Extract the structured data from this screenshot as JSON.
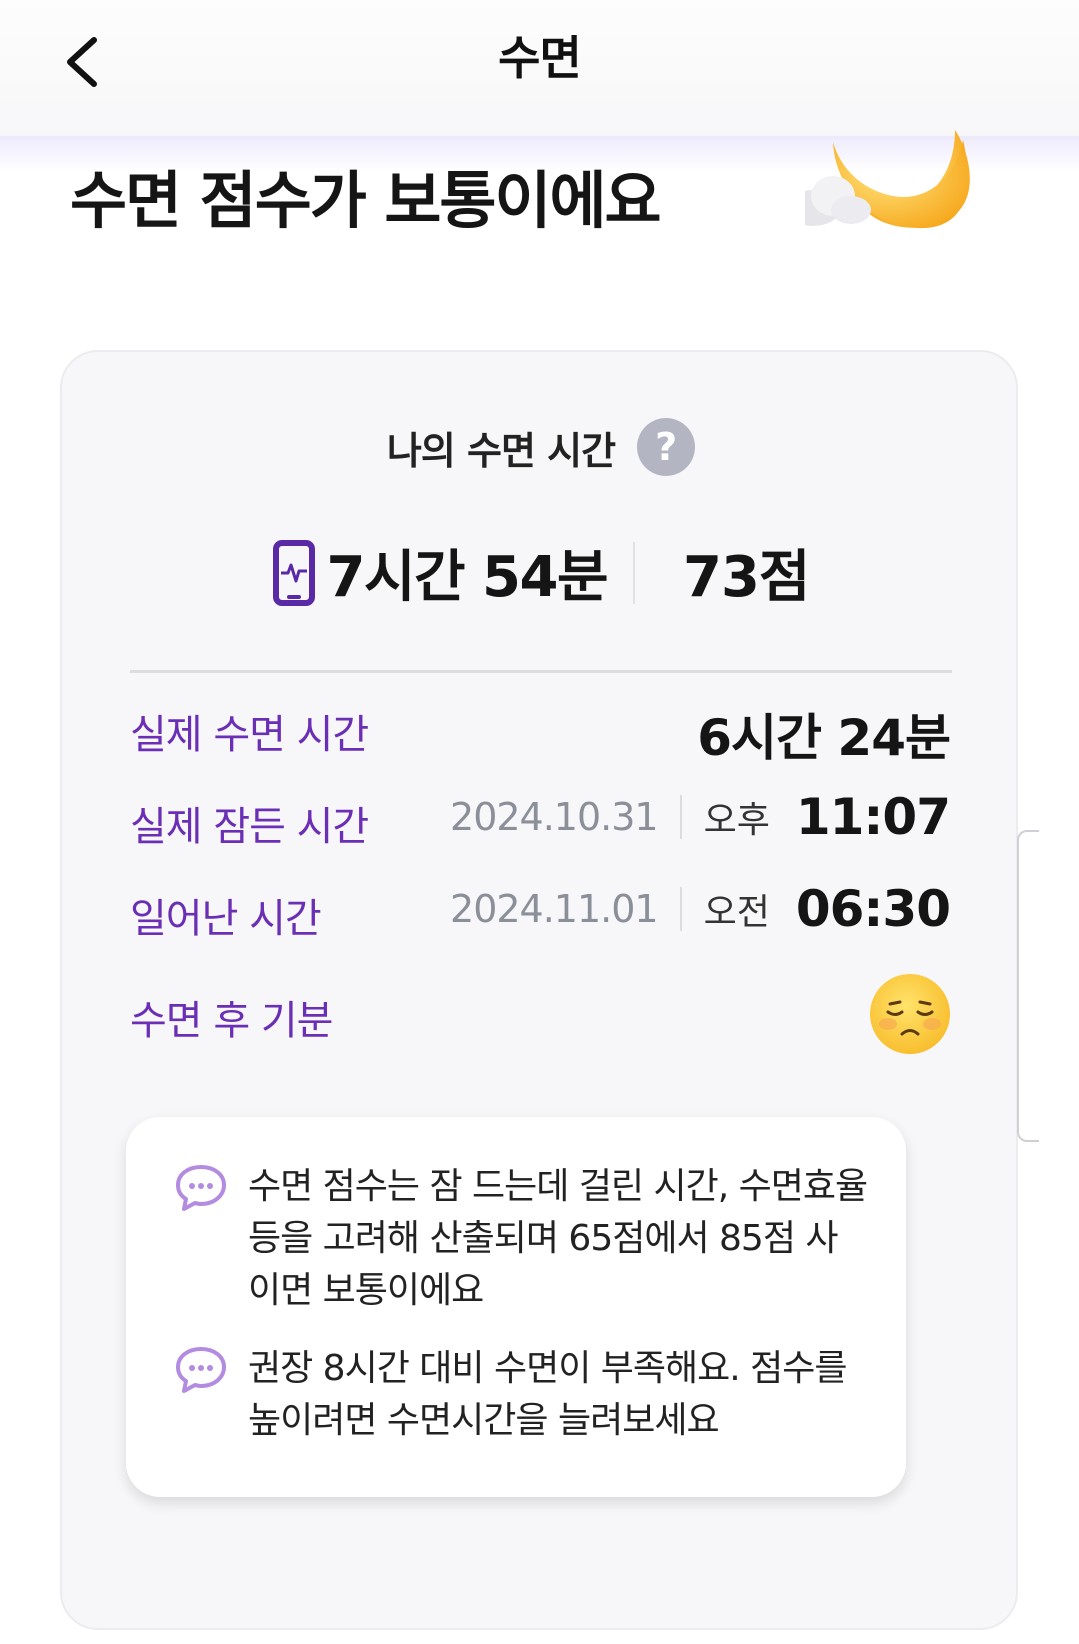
{
  "header": {
    "title": "수면",
    "back_icon": "chevron-left-icon"
  },
  "headline": "수면 점수가 보통이에요",
  "hero_icon": "moon-cloud-icon",
  "card": {
    "title": "나의 수면 시간",
    "help_label": "?",
    "device_icon": "phone-heartbeat-icon",
    "duration": "7시간 54분",
    "score": "73점",
    "rows": [
      {
        "label": "실제 수면 시간",
        "value": "6시간 24분"
      },
      {
        "label": "실제 잠든 시간",
        "date": "2024.10.31",
        "ampm": "오후",
        "time": "11:07"
      },
      {
        "label": "일어난 시간",
        "date": "2024.11.01",
        "ampm": "오전",
        "time": "06:30"
      },
      {
        "label": "수면 후 기분",
        "icon": "sad-face-icon"
      }
    ],
    "info": [
      "수면 점수는 잠 드는데 걸린 시간, 수면효율 등을 고려해 산출되며 65점에서 85점 사이면 보통이에요",
      "권장 8시간 대비 수면이 부족해요. 점수를 높이려면 수면시간을 늘려보세요"
    ]
  },
  "colors": {
    "accent": "#6a2fb4",
    "card_bg": "#f7f7f9",
    "date_gray": "#8b8f99"
  }
}
